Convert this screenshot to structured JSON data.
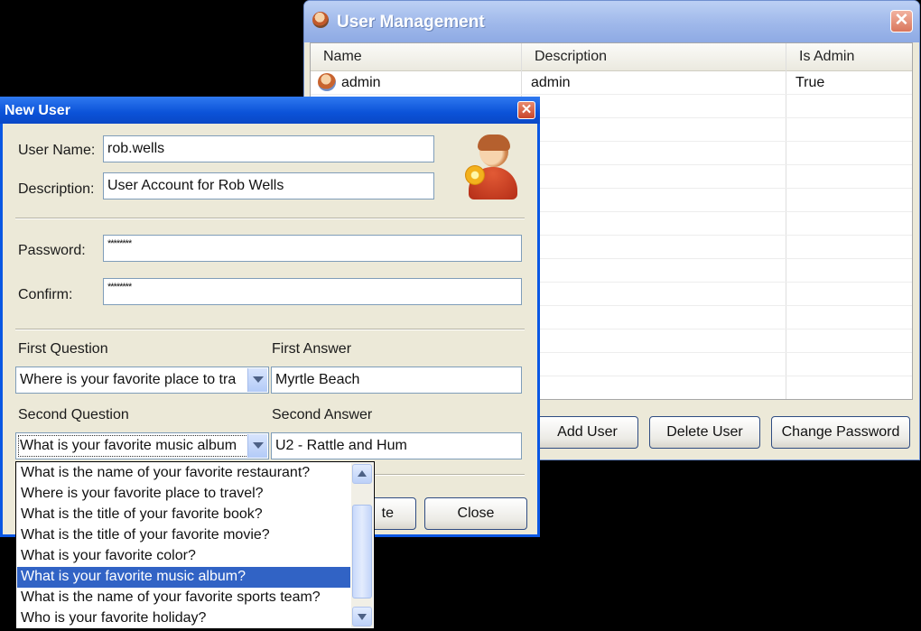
{
  "user_management": {
    "title": "User Management",
    "close_glyph": "✕",
    "columns": [
      "Name",
      "Description",
      "Is Admin"
    ],
    "rows": [
      {
        "name": "admin",
        "description": "admin",
        "is_admin": "True"
      }
    ],
    "buttons": {
      "add_user": "Add User",
      "delete_user": "Delete User",
      "change_password": "Change Password"
    }
  },
  "new_user": {
    "title": "New User",
    "close_glyph": "✕",
    "labels": {
      "user_name": "User Name:",
      "description": "Description:",
      "password": "Password:",
      "confirm": "Confirm:",
      "first_question": "First Question",
      "first_answer": "First Answer",
      "second_question": "Second Question",
      "second_answer": "Second Answer"
    },
    "values": {
      "user_name": "rob.wells",
      "description": "User Account for Rob Wells",
      "password": "********",
      "confirm": "********",
      "first_question": "Where is your favorite place to tra",
      "first_answer": "Myrtle Beach",
      "second_question": "What is your favorite music album",
      "second_answer": "U2 - Rattle and Hum"
    },
    "buttons": {
      "save_partial": "te",
      "close": "Close"
    }
  },
  "question_dropdown": {
    "options": [
      "What is the name of your favorite restaurant?",
      "Where is your favorite place to travel?",
      "What is the title of your favorite book?",
      "What is the title of your favorite movie?",
      "What is your favorite color?",
      "What is your favorite music album?",
      "What is the name of your favorite sports team?",
      "Who is your favorite holiday?"
    ],
    "selected_index": 5
  },
  "icons": {
    "um_title": "user-management-icon",
    "user_row": "user-icon",
    "avatar": "new-user-avatar-icon"
  },
  "colors": {
    "dialog_title_blue": "#0b52d8",
    "selection_blue": "#3163c5",
    "window_face": "#ece9d8"
  }
}
